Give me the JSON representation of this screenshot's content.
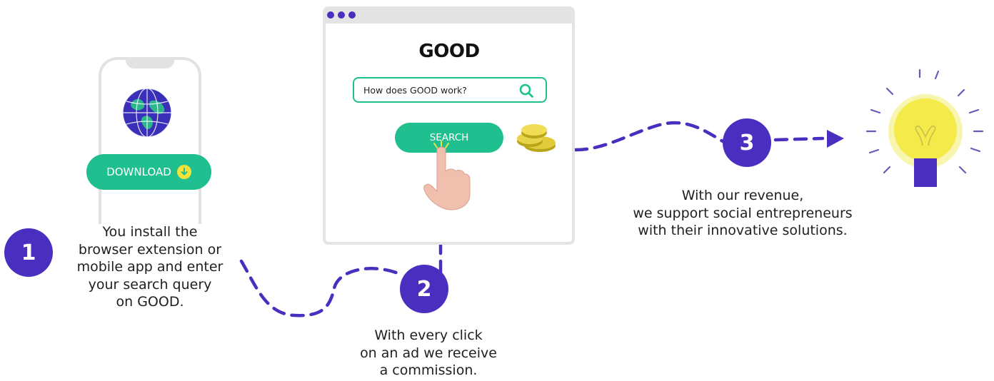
{
  "colors": {
    "accent": "#4a2ec0",
    "green": "#1fbf8f",
    "yellow": "#f2e23a",
    "gray": "#e4e4e4"
  },
  "steps": [
    {
      "number": "1",
      "lines": [
        "You install the",
        "browser extension or",
        "mobile app and enter",
        "your search query",
        "on GOOD."
      ]
    },
    {
      "number": "2",
      "lines": [
        "With every click",
        "on an ad we receive",
        "a commission."
      ]
    },
    {
      "number": "3",
      "lines": [
        "With our revenue,",
        "we support social entrepreneurs",
        "with their innovative solutions."
      ]
    }
  ],
  "phone": {
    "download_label": "DOWNLOAD",
    "icons": [
      "globe-icon",
      "download-arrow-icon"
    ]
  },
  "browser": {
    "logo": "GOOD",
    "search_value": "How does GOOD work?",
    "search_button": "SEARCH",
    "icons": [
      "search-icon",
      "coins-icon",
      "pointing-hand-icon"
    ]
  },
  "result": {
    "icons": [
      "lightbulb-icon"
    ]
  }
}
